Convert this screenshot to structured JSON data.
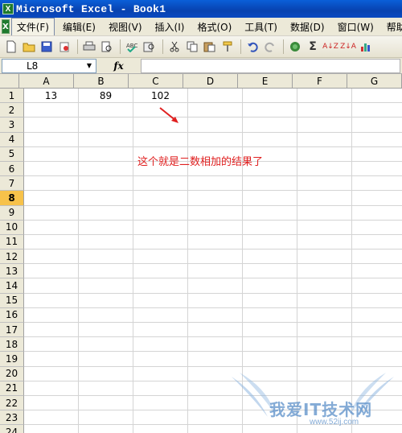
{
  "window": {
    "title": "Microsoft Excel - Book1",
    "app_icon_letter": "X"
  },
  "menubar": {
    "items": [
      "文件(F)",
      "编辑(E)",
      "视图(V)",
      "插入(I)",
      "格式(O)",
      "工具(T)",
      "数据(D)",
      "窗口(W)",
      "帮助(H)"
    ],
    "active_index": 0
  },
  "toolbar": {
    "buttons": [
      "new-icon",
      "open-icon",
      "save-icon",
      "permission-icon",
      "print-icon",
      "print-preview-icon",
      "spelling-icon",
      "research-icon",
      "cut-icon",
      "copy-icon",
      "paste-icon",
      "format-painter-icon",
      "undo-icon",
      "redo-icon",
      "hyperlink-icon",
      "autosum-icon",
      "sort-ascending-icon",
      "sort-descending-icon",
      "chart-icon"
    ]
  },
  "formula_bar": {
    "name_box": "L8",
    "fx_label": "fx",
    "formula": ""
  },
  "grid": {
    "columns": [
      "A",
      "B",
      "C",
      "D",
      "E",
      "F",
      "G"
    ],
    "rows": [
      "1",
      "2",
      "3",
      "4",
      "5",
      "6",
      "7",
      "8",
      "9",
      "10",
      "11",
      "12",
      "13",
      "14",
      "15",
      "16",
      "17",
      "18",
      "19",
      "20",
      "21",
      "22",
      "23",
      "24"
    ],
    "active_row": "8",
    "cells": {
      "A1": "13",
      "B1": "89",
      "C1": "102"
    }
  },
  "annotation": {
    "text": "这个就是二数相加的结果了",
    "color": "#e02020"
  },
  "watermark": {
    "text": "我爱IT技术网",
    "url": "www.52ij.com"
  }
}
